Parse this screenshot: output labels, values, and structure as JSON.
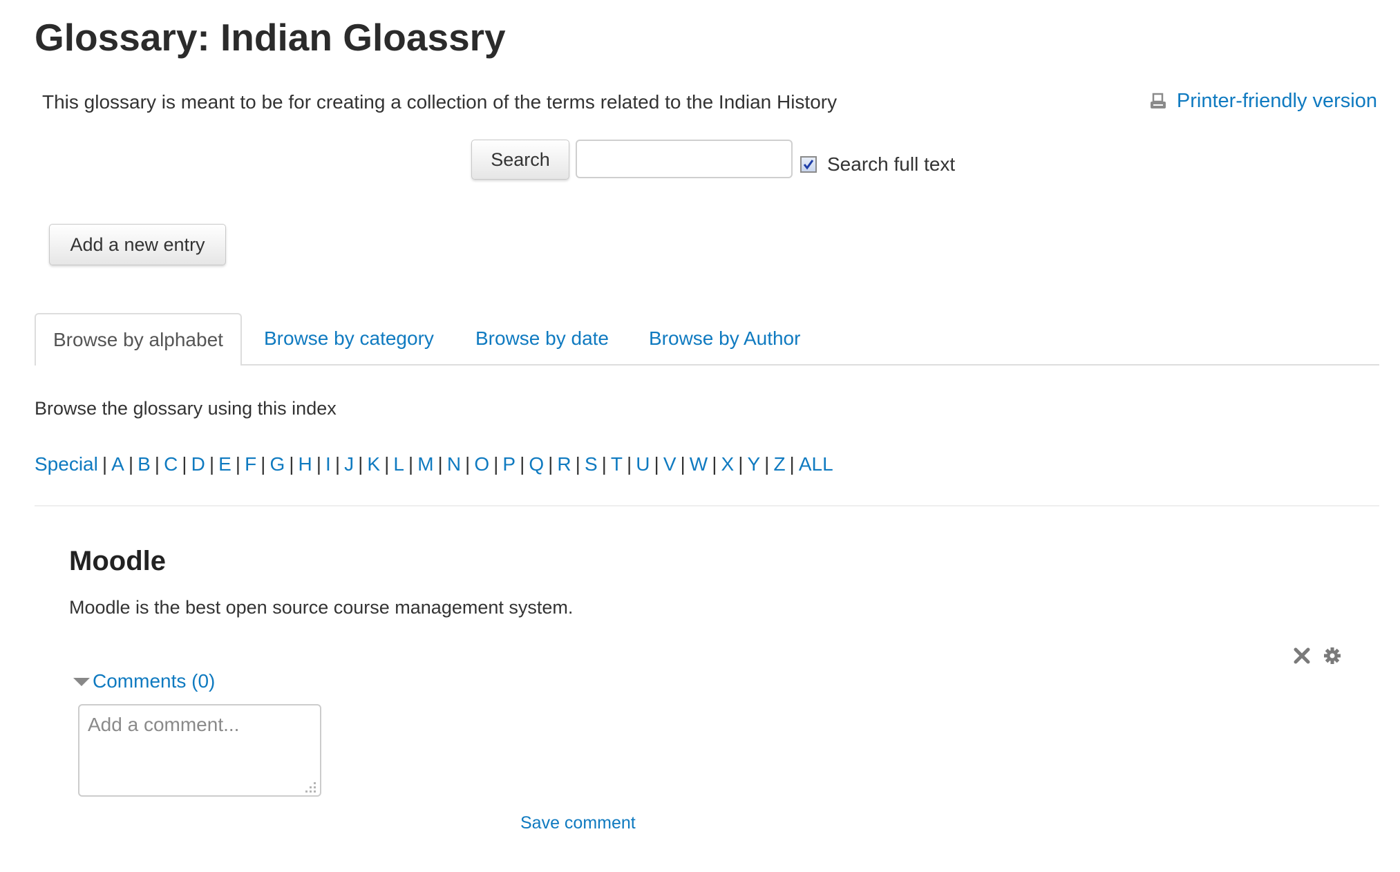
{
  "header": {
    "title": "Glossary: Indian Gloassry",
    "intro": "This glossary is meant to be for creating a collection of the terms related to the Indian History",
    "printer_link": "Printer-friendly version",
    "printer_icon": "printer-icon"
  },
  "search": {
    "button_label": "Search",
    "input_value": "",
    "input_placeholder": "",
    "fulltext_label": "Search full text",
    "fulltext_checked": true
  },
  "actions": {
    "add_entry_label": "Add a new entry"
  },
  "tabs": [
    {
      "label": "Browse by alphabet",
      "active": true
    },
    {
      "label": "Browse by category",
      "active": false
    },
    {
      "label": "Browse by date",
      "active": false
    },
    {
      "label": "Browse by Author",
      "active": false
    }
  ],
  "browse": {
    "hint": "Browse the glossary using this index",
    "index": [
      "Special",
      "A",
      "B",
      "C",
      "D",
      "E",
      "F",
      "G",
      "H",
      "I",
      "J",
      "K",
      "L",
      "M",
      "N",
      "O",
      "P",
      "Q",
      "R",
      "S",
      "T",
      "U",
      "V",
      "W",
      "X",
      "Y",
      "Z",
      "ALL"
    ]
  },
  "entry": {
    "term": "Moodle",
    "definition": "Moodle is the best open source course management system.",
    "action_icons": [
      "delete-icon",
      "edit-gear-icon"
    ],
    "comments_label": "Comments (0)",
    "comment_placeholder": "Add a comment...",
    "save_comment_label": "Save comment"
  },
  "colors": {
    "link": "#0f7ac0",
    "text": "#333333",
    "heading": "#2b2b2b",
    "border": "#dddddd"
  }
}
